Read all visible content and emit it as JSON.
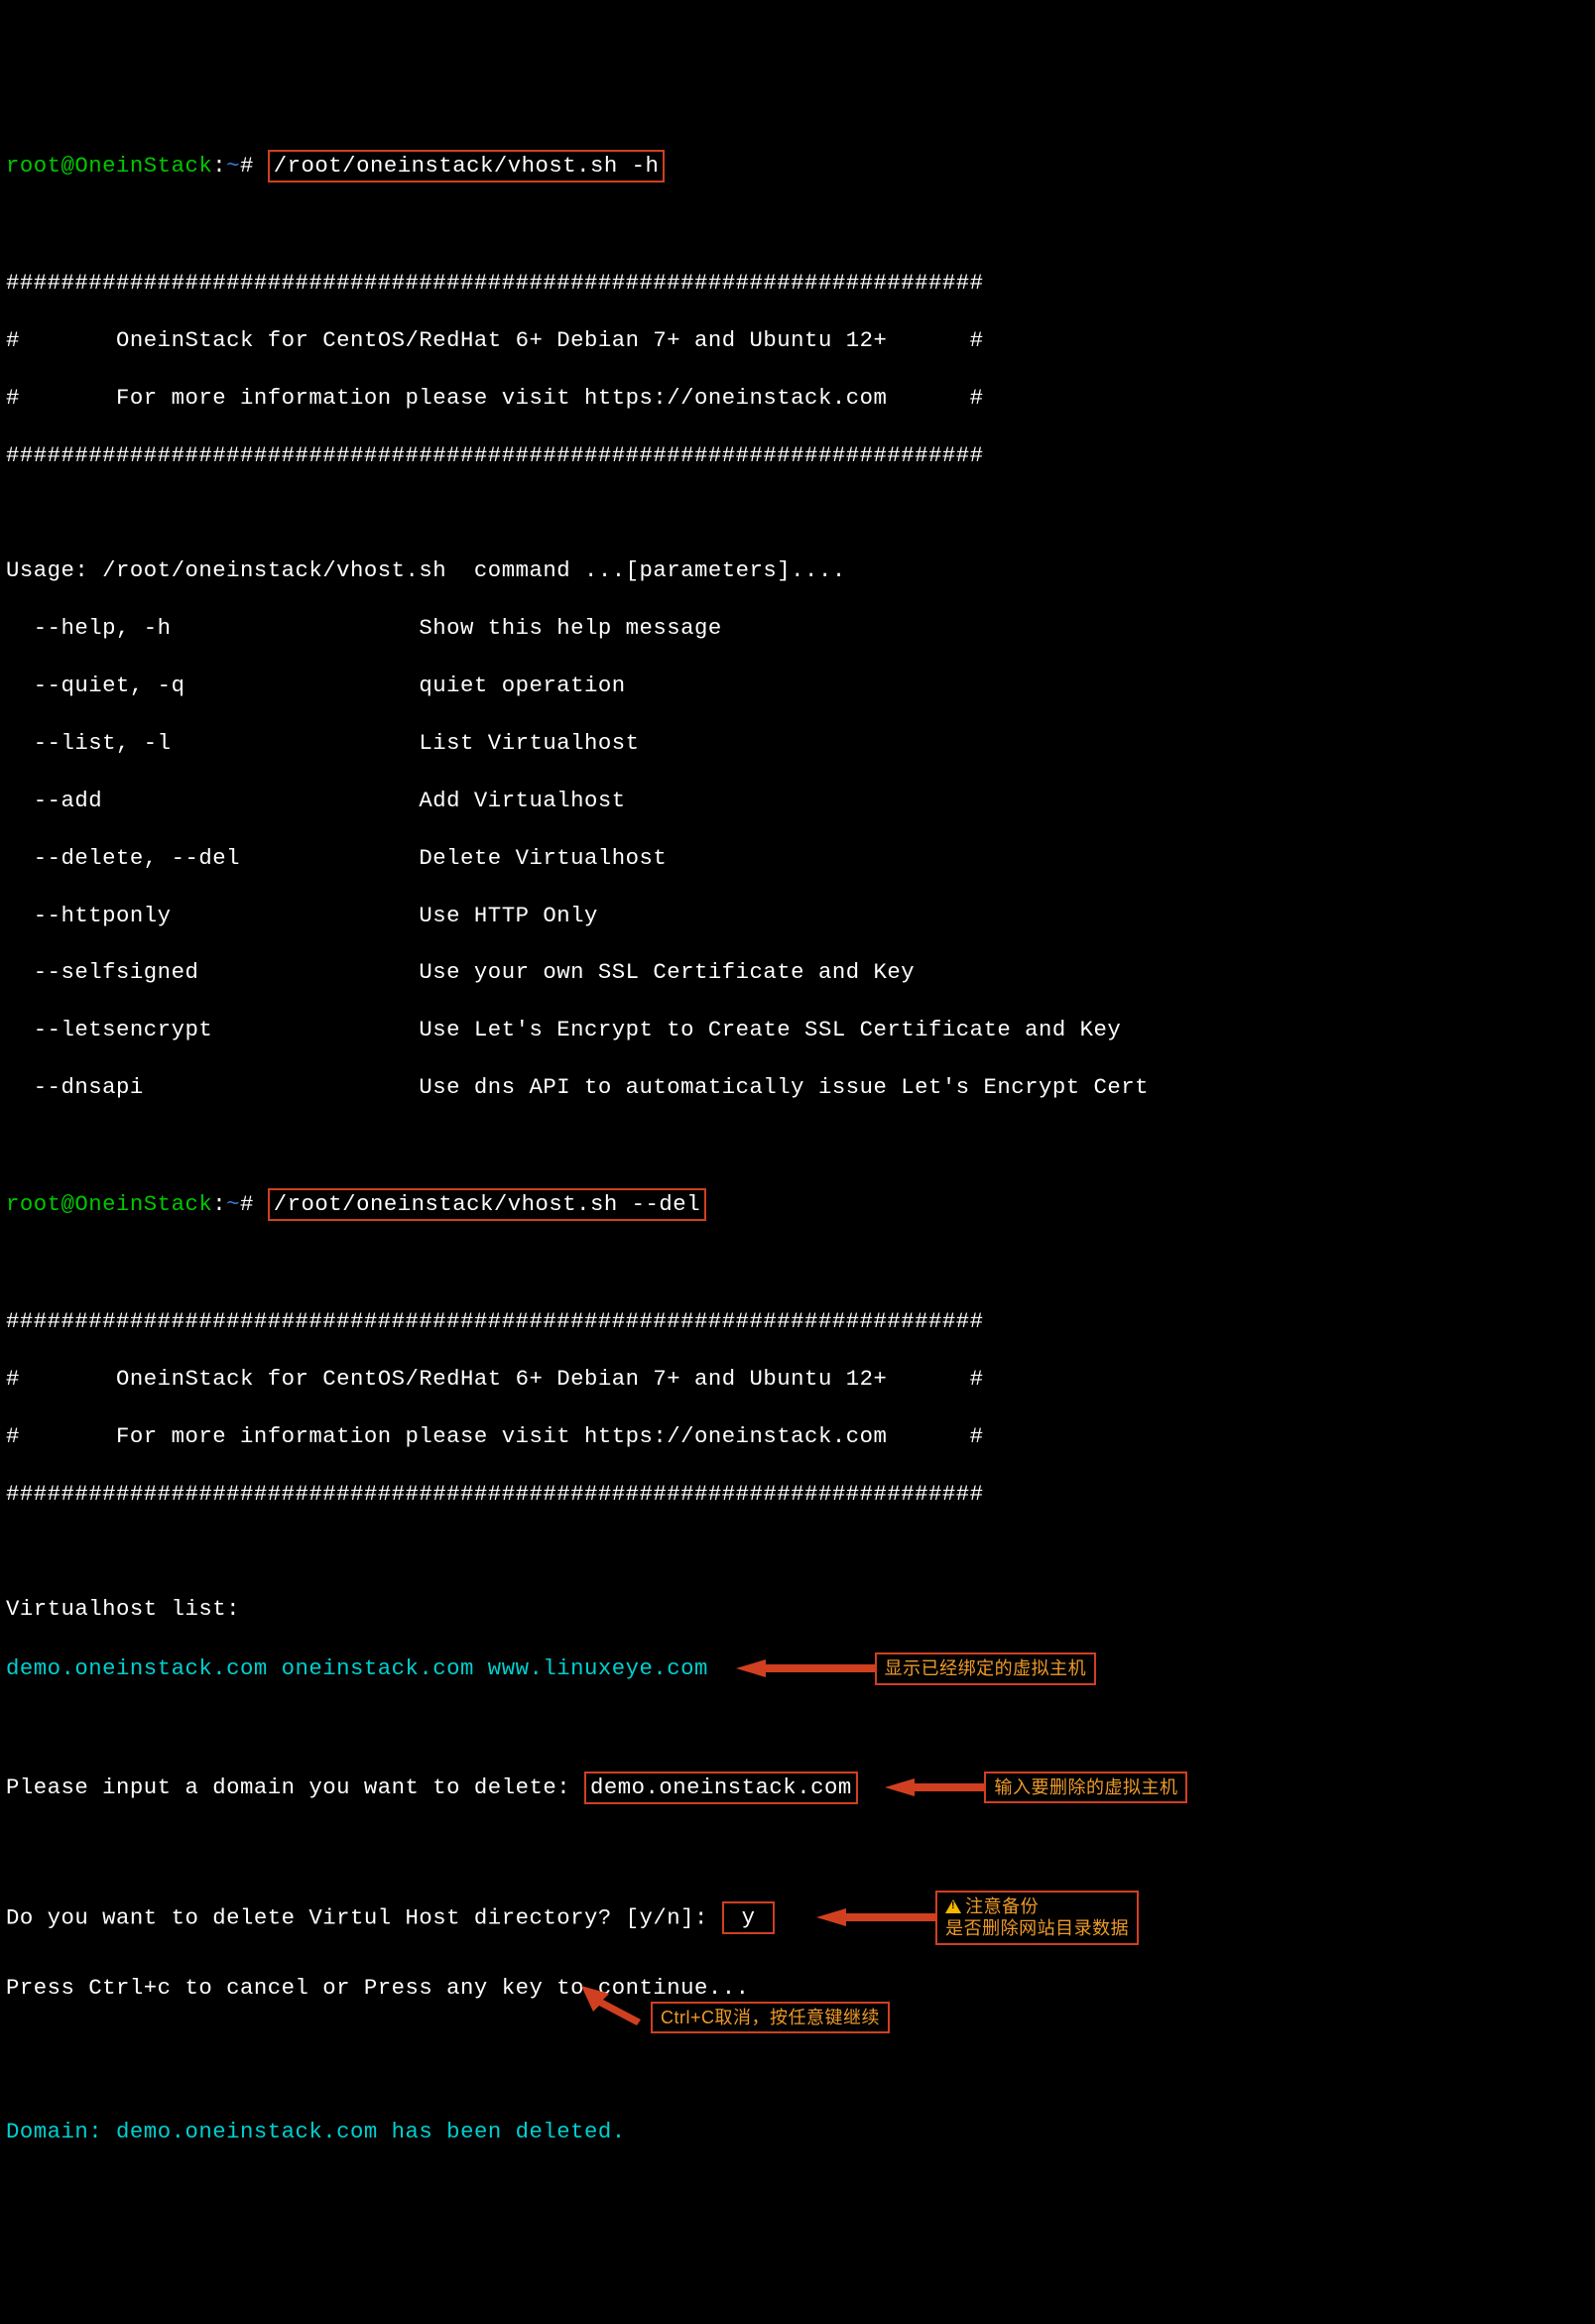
{
  "prompt1": {
    "user": "root@OneinStack",
    "sep": ":",
    "path": "~",
    "hash": "#",
    "cmd": "/root/oneinstack/vhost.sh -h"
  },
  "hashline": "#######################################################################",
  "banner1": "#       OneinStack for CentOS/RedHat 6+ Debian 7+ and Ubuntu 12+      #",
  "banner2": "#       For more information please visit https://oneinstack.com      #",
  "usage": "Usage: /root/oneinstack/vhost.sh  command ...[parameters]....",
  "opts": [
    "  --help, -h                  Show this help message",
    "  --quiet, -q                 quiet operation",
    "  --list, -l                  List Virtualhost",
    "  --add                       Add Virtualhost",
    "  --delete, --del             Delete Virtualhost",
    "  --httponly                  Use HTTP Only",
    "  --selfsigned                Use your own SSL Certificate and Key",
    "  --letsencrypt               Use Let's Encrypt to Create SSL Certificate and Key",
    "  --dnsapi                    Use dns API to automatically issue Let's Encrypt Cert"
  ],
  "prompt2": {
    "user": "root@OneinStack",
    "sep": ":",
    "path": "~",
    "hash": "#",
    "cmd": "/root/oneinstack/vhost.sh --del"
  },
  "vh_label": "Virtualhost list:",
  "vh_list": "demo.oneinstack.com oneinstack.com www.linuxeye.com",
  "input_prompt": "Please input a domain you want to delete: ",
  "input_val": "demo.oneinstack.com",
  "confirm_prompt": "Do you want to delete Virtul Host directory? [y/n]: ",
  "confirm_val": "y",
  "press_line": "Press Ctrl+c to cancel or Press any key to continue...",
  "result_pre": "Domain: ",
  "result_domain": "demo.oneinstack.com",
  "result_post": " has been deleted.",
  "annotations": {
    "a1": "显示已经绑定的虚拟主机",
    "a2": "输入要删除的虚拟主机",
    "a3_line1": "注意备份",
    "a3_line2": "是否删除网站目录数据",
    "a4": "Ctrl+C取消，按任意键继续"
  }
}
